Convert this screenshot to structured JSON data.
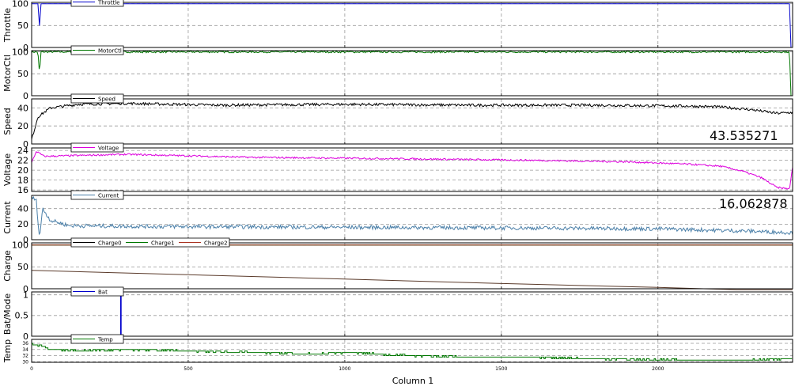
{
  "chart_data": {
    "type": "line",
    "xlabel": "Column 1",
    "xlim": [
      0,
      2430
    ],
    "x_ticks": [
      "0",
      "500",
      "1000",
      "1500",
      "2000"
    ],
    "grid": true,
    "panels": [
      {
        "id": "throttle",
        "ylabel": "Throttle",
        "ylim": [
          0,
          103
        ],
        "y_ticks": [
          {
            "v": 0,
            "t": "0"
          },
          {
            "v": 50,
            "t": "50"
          },
          {
            "v": 100,
            "t": "100"
          }
        ],
        "tick_font": 11,
        "legend": "top-left",
        "series": [
          {
            "name": "Throttle",
            "color": "#0000cc",
            "kind": "steps",
            "points": [
              [
                0,
                100
              ],
              [
                20,
                100
              ],
              [
                25,
                50
              ],
              [
                30,
                100
              ],
              [
                2420,
                100
              ],
              [
                2425,
                0
              ]
            ]
          }
        ]
      },
      {
        "id": "motorctl",
        "ylabel": "MotorCtl",
        "ylim": [
          0,
          103
        ],
        "y_ticks": [
          {
            "v": 0,
            "t": "0"
          },
          {
            "v": 50,
            "t": "50"
          },
          {
            "v": 100,
            "t": "100"
          }
        ],
        "tick_font": 11,
        "legend": "top-left",
        "series": [
          {
            "name": "MotorCtl",
            "color": "#007700",
            "kind": "noisy",
            "points": [
              [
                0,
                100
              ],
              [
                20,
                100
              ],
              [
                25,
                50
              ],
              [
                30,
                100
              ],
              [
                2420,
                100
              ],
              [
                2425,
                0
              ]
            ],
            "amp": 4
          }
        ]
      },
      {
        "id": "speed",
        "ylabel": "Speed",
        "ylim": [
          0,
          50
        ],
        "y_ticks": [
          {
            "v": 0,
            "t": "0"
          },
          {
            "v": 20,
            "t": "20"
          },
          {
            "v": 40,
            "t": "40"
          }
        ],
        "tick_font": 11,
        "legend": "top-left",
        "readout": "43.535271",
        "series": [
          {
            "name": "Speed",
            "color": "#000000",
            "kind": "noisy",
            "points": [
              [
                0,
                5
              ],
              [
                20,
                30
              ],
              [
                60,
                40
              ],
              [
                150,
                44
              ],
              [
                300,
                45
              ],
              [
                600,
                43
              ],
              [
                1000,
                44
              ],
              [
                1400,
                43
              ],
              [
                1800,
                43
              ],
              [
                2100,
                42
              ],
              [
                2200,
                41
              ],
              [
                2300,
                38
              ],
              [
                2380,
                34
              ],
              [
                2430,
                35
              ]
            ],
            "amp": 3
          }
        ]
      },
      {
        "id": "voltage",
        "ylabel": "Voltage",
        "ylim": [
          15.7,
          24.5
        ],
        "y_ticks": [
          {
            "v": 16,
            "t": "16"
          },
          {
            "v": 18,
            "t": "18"
          },
          {
            "v": 20,
            "t": "20"
          },
          {
            "v": 22,
            "t": "22"
          },
          {
            "v": 24,
            "t": "24"
          }
        ],
        "tick_font": 11,
        "legend": "top-left",
        "series": [
          {
            "name": "Voltage",
            "color": "#dd00dd",
            "kind": "noisy",
            "points": [
              [
                0,
                21.5
              ],
              [
                15,
                23.8
              ],
              [
                40,
                22.8
              ],
              [
                300,
                23.2
              ],
              [
                700,
                22.6
              ],
              [
                1200,
                22.3
              ],
              [
                1600,
                22
              ],
              [
                1900,
                21.7
              ],
              [
                2100,
                21.2
              ],
              [
                2200,
                20.8
              ],
              [
                2270,
                19.8
              ],
              [
                2330,
                18.5
              ],
              [
                2380,
                16.5
              ],
              [
                2420,
                16.2
              ],
              [
                2430,
                20.5
              ]
            ],
            "amp": 0.35
          }
        ]
      },
      {
        "id": "current",
        "ylabel": "Current",
        "ylim": [
          0,
          57
        ],
        "y_ticks": [
          {
            "v": 0,
            "t": "0"
          },
          {
            "v": 20,
            "t": "20"
          },
          {
            "v": 40,
            "t": "40"
          }
        ],
        "tick_font": 11,
        "legend": "top-left",
        "readout": "16.062878",
        "series": [
          {
            "name": "Current",
            "color": "#4a7fa8",
            "kind": "noisy",
            "points": [
              [
                0,
                55
              ],
              [
                15,
                50
              ],
              [
                25,
                2
              ],
              [
                35,
                40
              ],
              [
                60,
                25
              ],
              [
                120,
                18
              ],
              [
                400,
                17
              ],
              [
                1000,
                16
              ],
              [
                1600,
                15
              ],
              [
                2000,
                14
              ],
              [
                2300,
                11
              ],
              [
                2430,
                9
              ]
            ],
            "amp": 5
          }
        ]
      },
      {
        "id": "charge",
        "ylabel": "Charge",
        "ylim": [
          0,
          105
        ],
        "y_ticks": [
          {
            "v": 0,
            "t": "0"
          },
          {
            "v": 50,
            "t": "50"
          },
          {
            "v": 100,
            "t": "100"
          }
        ],
        "tick_font": 11,
        "legend": "top-left",
        "series": [
          {
            "name": "Charge0",
            "color": "#000000",
            "kind": "line",
            "points": [
              [
                0,
                100
              ],
              [
                2430,
                100
              ]
            ]
          },
          {
            "name": "Charge1",
            "color": "#007700",
            "kind": "line",
            "points": [
              [
                0,
                100
              ],
              [
                2430,
                100
              ]
            ]
          },
          {
            "name": "Charge2",
            "color": "#aa3322",
            "kind": "line",
            "points": [
              [
                0,
                100
              ],
              [
                2430,
                100
              ]
            ]
          },
          {
            "name": "",
            "color": "#5a3a2a",
            "kind": "line",
            "points": [
              [
                0,
                42
              ],
              [
                500,
                32
              ],
              [
                1000,
                22
              ],
              [
                1500,
                12
              ],
              [
                2000,
                3
              ],
              [
                2250,
                -3
              ],
              [
                2430,
                -3
              ]
            ]
          }
        ]
      },
      {
        "id": "batmode",
        "ylabel": "Bat/Mode",
        "ylim": [
          0,
          1.07
        ],
        "y_ticks": [
          {
            "v": 0,
            "t": "0"
          },
          {
            "v": 0.5,
            "t": "0.5"
          },
          {
            "v": 1,
            "t": "1"
          }
        ],
        "tick_font": 11,
        "legend": "top-left",
        "series": [
          {
            "name": "Bat",
            "color": "#0000cc",
            "kind": "steps",
            "points": [
              [
                0,
                0
              ],
              [
                284,
                0
              ],
              [
                284,
                1.1
              ],
              [
                286,
                1.1
              ],
              [
                286,
                0
              ],
              [
                2430,
                0
              ]
            ]
          }
        ]
      },
      {
        "id": "temp",
        "ylabel": "Temp",
        "ylim": [
          29.8,
          37.3
        ],
        "y_ticks": [
          {
            "v": 30,
            "t": "30"
          },
          {
            "v": 32,
            "t": "32"
          },
          {
            "v": 34,
            "t": "34"
          },
          {
            "v": 36,
            "t": "36"
          }
        ],
        "tick_font": 6,
        "legend": "top-left",
        "series": [
          {
            "name": "Temp",
            "color": "#007700",
            "kind": "steps",
            "points": [
              [
                0,
                36
              ],
              [
                30,
                35
              ],
              [
                60,
                34
              ],
              [
                150,
                33.5
              ],
              [
                300,
                34
              ],
              [
                500,
                33.5
              ],
              [
                700,
                33
              ],
              [
                900,
                32.5
              ],
              [
                1000,
                33
              ],
              [
                1200,
                32
              ],
              [
                1400,
                31.5
              ],
              [
                1600,
                31.5
              ],
              [
                1800,
                31
              ],
              [
                2100,
                30.5
              ],
              [
                2300,
                30.5
              ],
              [
                2430,
                31
              ]
            ],
            "amp": 0.5
          }
        ]
      }
    ]
  }
}
